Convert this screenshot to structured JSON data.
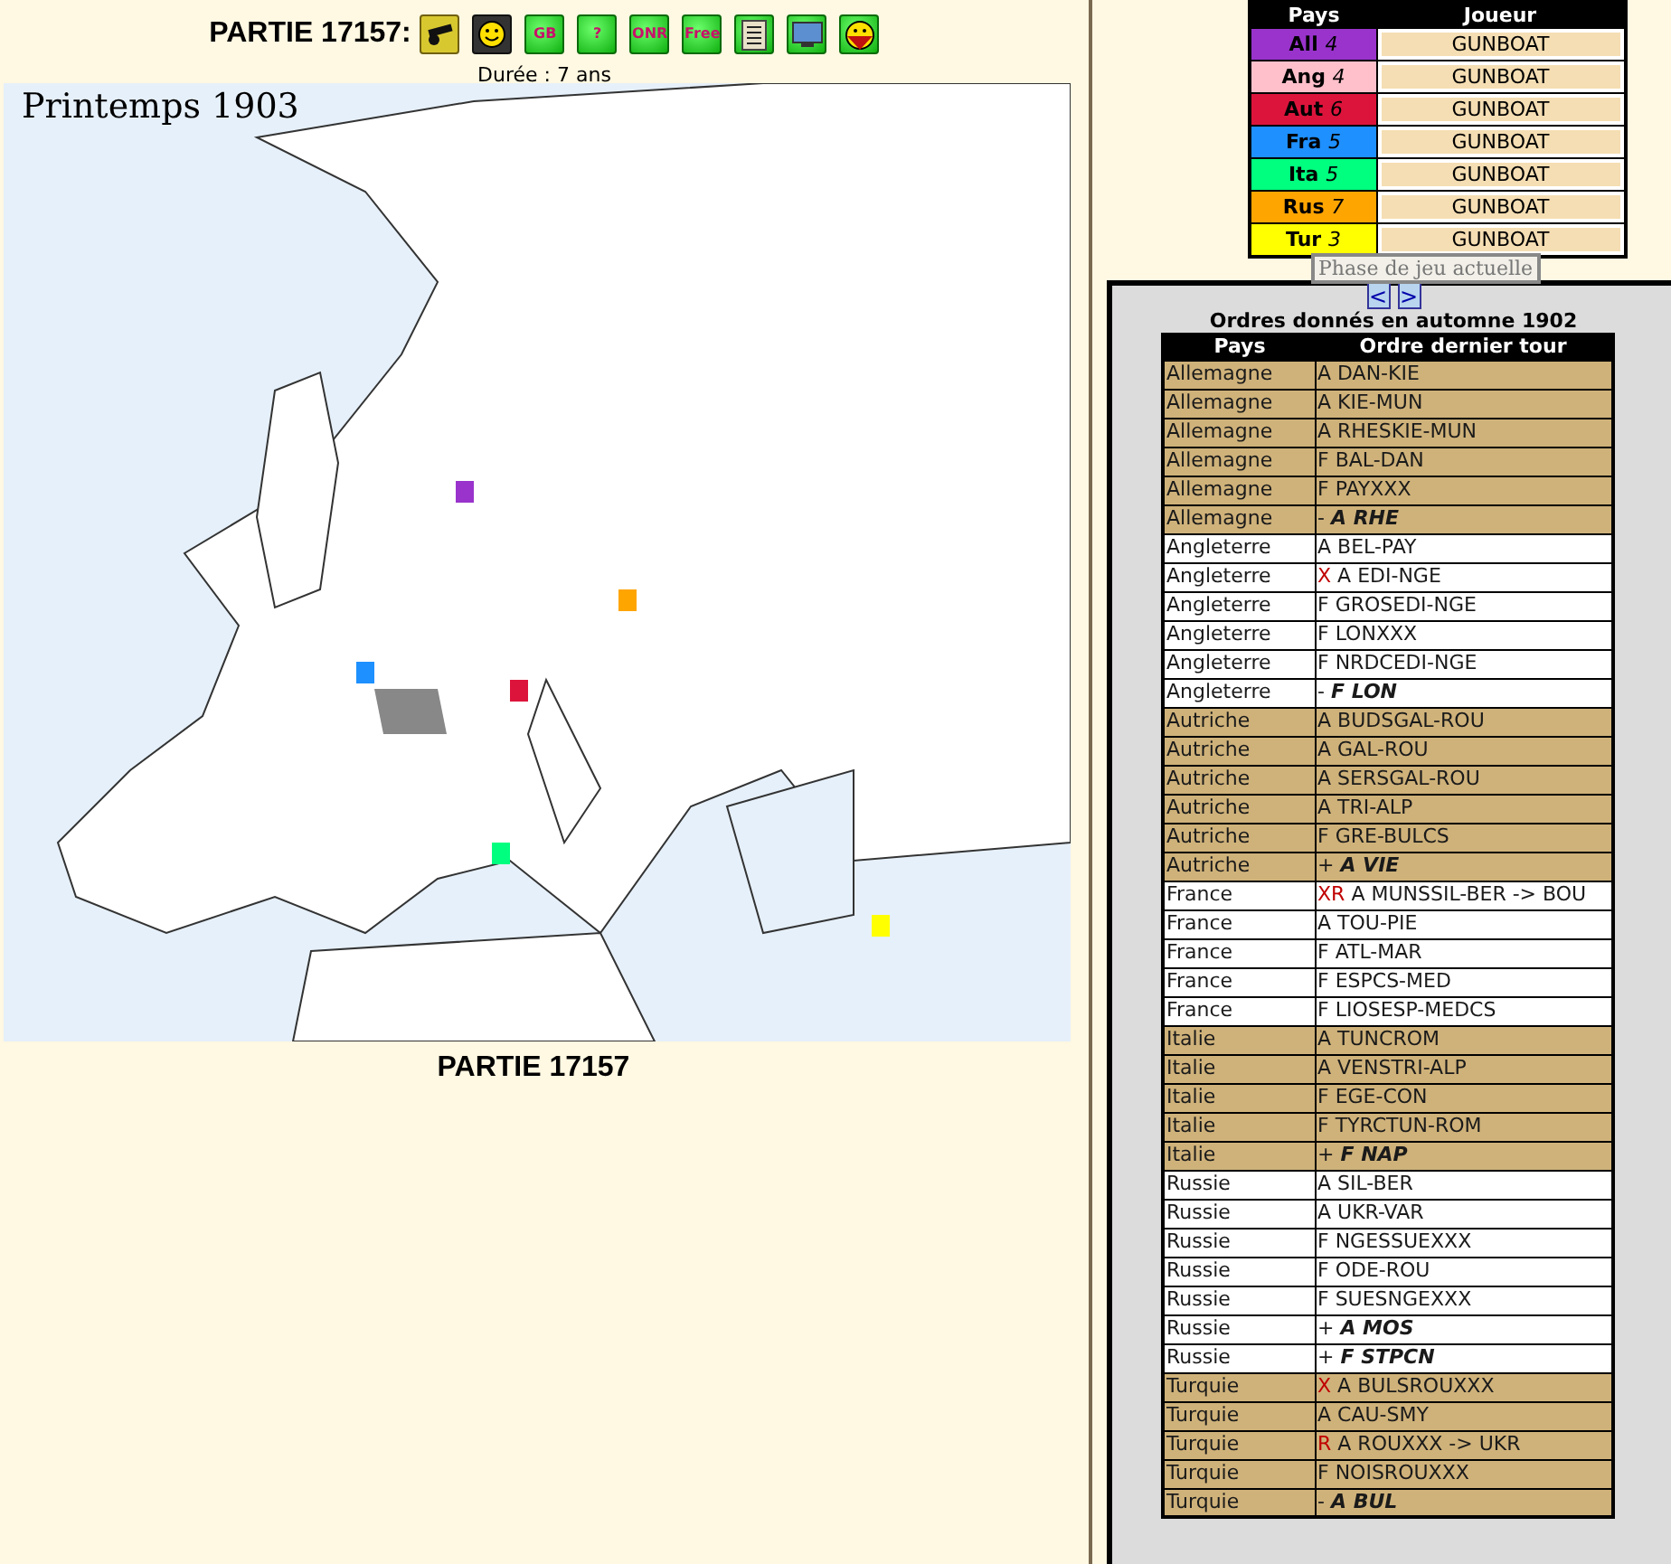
{
  "game": {
    "title": "PARTIE 17157:",
    "duration": "Durée : 7 ans",
    "caption": "PARTIE 17157"
  },
  "toolbar": [
    {
      "kind": "cannon"
    },
    {
      "kind": "smiley"
    },
    {
      "kind": "label",
      "text": "GB"
    },
    {
      "kind": "label",
      "text": "?"
    },
    {
      "kind": "label",
      "text": "ONR"
    },
    {
      "kind": "label",
      "text": "Free"
    },
    {
      "kind": "document"
    },
    {
      "kind": "screen"
    },
    {
      "kind": "masked-smiley"
    }
  ],
  "map": {
    "season": "Printemps 1903"
  },
  "powers": {
    "columns": [
      "Pays",
      "Joueur"
    ],
    "rows": [
      {
        "code": "All",
        "count": "4",
        "color": "#9933cc",
        "player": "GUNBOAT"
      },
      {
        "code": "Ang",
        "count": "4",
        "color": "#ffc0cb",
        "player": "GUNBOAT"
      },
      {
        "code": "Aut",
        "count": "6",
        "color": "#dc143c",
        "player": "GUNBOAT"
      },
      {
        "code": "Fra",
        "count": "5",
        "color": "#1e90ff",
        "player": "GUNBOAT"
      },
      {
        "code": "Ita",
        "count": "5",
        "color": "#00ff7f",
        "player": "GUNBOAT"
      },
      {
        "code": "Rus",
        "count": "7",
        "color": "#ffa500",
        "player": "GUNBOAT"
      },
      {
        "code": "Tur",
        "count": "3",
        "color": "#ffff00",
        "player": "GUNBOAT"
      }
    ]
  },
  "phase_button": "Phase de jeu actuelle",
  "nav": [
    "<",
    ">"
  ],
  "orders": {
    "title": "Ordres donnés en automne 1902",
    "columns": [
      "Pays",
      "Ordre dernier tour"
    ],
    "rows": [
      {
        "country": "Allemagne",
        "shaded": true,
        "kind": "order",
        "order": "A DAN-KIE"
      },
      {
        "country": "Allemagne",
        "shaded": true,
        "kind": "order",
        "order": "A KIE-MUN"
      },
      {
        "country": "Allemagne",
        "shaded": true,
        "kind": "order",
        "order": "A RHESKIE-MUN"
      },
      {
        "country": "Allemagne",
        "shaded": true,
        "kind": "order",
        "order": "F BAL-DAN"
      },
      {
        "country": "Allemagne",
        "shaded": true,
        "kind": "order",
        "order": "F PAYXXX"
      },
      {
        "country": "Allemagne",
        "shaded": true,
        "kind": "adjustment",
        "sign": "-",
        "order": "A RHE"
      },
      {
        "country": "Angleterre",
        "shaded": false,
        "kind": "order",
        "order": "A BEL-PAY"
      },
      {
        "country": "Angleterre",
        "shaded": false,
        "kind": "order",
        "flag": "X",
        "order": "A EDI-NGE"
      },
      {
        "country": "Angleterre",
        "shaded": false,
        "kind": "order",
        "order": "F GROSEDI-NGE"
      },
      {
        "country": "Angleterre",
        "shaded": false,
        "kind": "order",
        "order": "F LONXXX"
      },
      {
        "country": "Angleterre",
        "shaded": false,
        "kind": "order",
        "order": "F NRDCEDI-NGE"
      },
      {
        "country": "Angleterre",
        "shaded": false,
        "kind": "adjustment",
        "sign": "-",
        "order": "F LON"
      },
      {
        "country": "Autriche",
        "shaded": true,
        "kind": "order",
        "order": "A BUDSGAL-ROU"
      },
      {
        "country": "Autriche",
        "shaded": true,
        "kind": "order",
        "order": "A GAL-ROU"
      },
      {
        "country": "Autriche",
        "shaded": true,
        "kind": "order",
        "order": "A SERSGAL-ROU"
      },
      {
        "country": "Autriche",
        "shaded": true,
        "kind": "order",
        "order": "A TRI-ALP"
      },
      {
        "country": "Autriche",
        "shaded": true,
        "kind": "order",
        "order": "F GRE-BULCS"
      },
      {
        "country": "Autriche",
        "shaded": true,
        "kind": "adjustment",
        "sign": "+",
        "order": "A VIE"
      },
      {
        "country": "France",
        "shaded": false,
        "kind": "order",
        "flag": "XR",
        "order": "A MUNSSIL-BER -> BOU"
      },
      {
        "country": "France",
        "shaded": false,
        "kind": "order",
        "order": "A TOU-PIE"
      },
      {
        "country": "France",
        "shaded": false,
        "kind": "order",
        "order": "F ATL-MAR"
      },
      {
        "country": "France",
        "shaded": false,
        "kind": "order",
        "order": "F ESPCS-MED"
      },
      {
        "country": "France",
        "shaded": false,
        "kind": "order",
        "order": "F LIOSESP-MEDCS"
      },
      {
        "country": "Italie",
        "shaded": true,
        "kind": "order",
        "order": "A TUNCROM"
      },
      {
        "country": "Italie",
        "shaded": true,
        "kind": "order",
        "order": "A VENSTRI-ALP"
      },
      {
        "country": "Italie",
        "shaded": true,
        "kind": "order",
        "order": "F EGE-CON"
      },
      {
        "country": "Italie",
        "shaded": true,
        "kind": "order",
        "order": "F TYRCTUN-ROM"
      },
      {
        "country": "Italie",
        "shaded": true,
        "kind": "adjustment",
        "sign": "+",
        "order": "F NAP"
      },
      {
        "country": "Russie",
        "shaded": false,
        "kind": "order",
        "order": "A SIL-BER"
      },
      {
        "country": "Russie",
        "shaded": false,
        "kind": "order",
        "order": "A UKR-VAR"
      },
      {
        "country": "Russie",
        "shaded": false,
        "kind": "order",
        "order": "F NGESSUEXXX"
      },
      {
        "country": "Russie",
        "shaded": false,
        "kind": "order",
        "order": "F ODE-ROU"
      },
      {
        "country": "Russie",
        "shaded": false,
        "kind": "order",
        "order": "F SUESNGEXXX"
      },
      {
        "country": "Russie",
        "shaded": false,
        "kind": "adjustment",
        "sign": "+",
        "order": "A MOS"
      },
      {
        "country": "Russie",
        "shaded": false,
        "kind": "adjustment",
        "sign": "+",
        "order": "F STPCN"
      },
      {
        "country": "Turquie",
        "shaded": true,
        "kind": "order",
        "flag": "X",
        "order": "A BULSROUXXX"
      },
      {
        "country": "Turquie",
        "shaded": true,
        "kind": "order",
        "order": "A CAU-SMY"
      },
      {
        "country": "Turquie",
        "shaded": true,
        "kind": "order",
        "flag": "R",
        "order": "A ROUXXX -> UKR"
      },
      {
        "country": "Turquie",
        "shaded": true,
        "kind": "order",
        "order": "F NOISROUXXX"
      },
      {
        "country": "Turquie",
        "shaded": true,
        "kind": "adjustment",
        "sign": "-",
        "order": "A BUL"
      }
    ]
  }
}
